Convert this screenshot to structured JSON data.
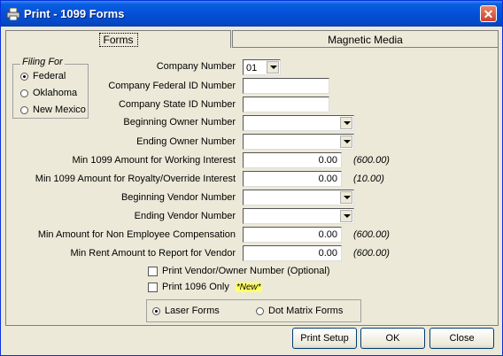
{
  "window": {
    "title": "Print - 1099 Forms",
    "title_icon": "printer-icon",
    "close_icon": "close-icon",
    "close_glyph": "✕",
    "accent": "#0a5fe0"
  },
  "tabs": [
    {
      "label": "Forms",
      "selected": true
    },
    {
      "label": "Magnetic Media",
      "selected": false
    }
  ],
  "filing_for": {
    "title": "Filing For",
    "options": [
      {
        "label": "Federal",
        "selected": true
      },
      {
        "label": "Oklahoma",
        "selected": false
      },
      {
        "label": "New Mexico",
        "selected": false
      }
    ]
  },
  "fields": {
    "company_number": {
      "label": "Company Number",
      "value": "01"
    },
    "company_federal_id": {
      "label": "Company Federal ID Number",
      "value": ""
    },
    "company_state_id": {
      "label": "Company State ID Number",
      "value": ""
    },
    "beginning_owner": {
      "label": "Beginning Owner Number",
      "value": ""
    },
    "ending_owner": {
      "label": "Ending Owner Number",
      "value": ""
    },
    "min_working_interest": {
      "label": "Min 1099 Amount for Working Interest",
      "value": "0.00",
      "hint": "(600.00)"
    },
    "min_royalty_override": {
      "label": "Min 1099 Amount for Royalty/Override Interest",
      "value": "0.00",
      "hint": "(10.00)"
    },
    "beginning_vendor": {
      "label": "Beginning Vendor Number",
      "value": ""
    },
    "ending_vendor": {
      "label": "Ending Vendor Number",
      "value": ""
    },
    "min_non_employee": {
      "label": "Min Amount for Non Employee Compensation",
      "value": "0.00",
      "hint": "(600.00)"
    },
    "min_rent": {
      "label": "Min Rent Amount to Report for Vendor",
      "value": "0.00",
      "hint": "(600.00)"
    }
  },
  "checkboxes": {
    "print_vendor_owner": {
      "label": "Print Vendor/Owner Number (Optional)",
      "checked": false
    },
    "print_1096_only": {
      "label": "Print 1096 Only",
      "checked": false,
      "badge": "*New*"
    }
  },
  "form_type": {
    "options": [
      {
        "label": "Laser Forms",
        "selected": true
      },
      {
        "label": "Dot Matrix Forms",
        "selected": false
      }
    ]
  },
  "buttons": {
    "print_setup": "Print Setup",
    "ok": "OK",
    "close": "Close"
  }
}
